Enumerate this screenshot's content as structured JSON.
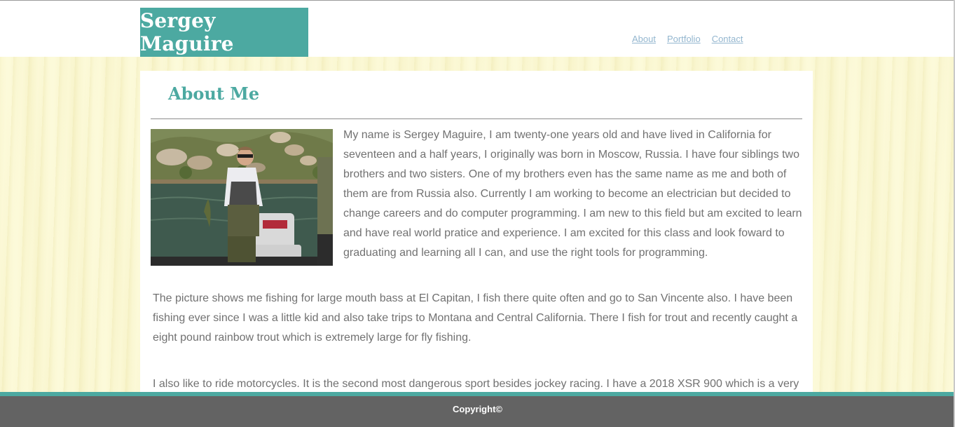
{
  "header": {
    "logo_text": "Sergey Maguire",
    "nav": [
      {
        "label": "About"
      },
      {
        "label": "Portfolio"
      },
      {
        "label": "Contact"
      }
    ]
  },
  "main": {
    "title": "About Me",
    "paragraphs": [
      "My name is Sergey Maguire, I am twenty-one years old and have lived in California for seventeen and a half years, I originally was born in Moscow, Russia. I have four siblings two brothers and two sisters. One of my brothers even has the same name as me and both of them are from Russia also. Currently I am working to become an electrician but decided to change careers and do computer programming. I am new to this field but am excited to learn and have real world pratice and experience. I am excited for this class and look foward to graduating and learning all I can, and use the right tools for programming.",
      "The picture shows me fishing for large mouth bass at El Capitan, I fish there quite often and go to San Vincente also. I have been fishing ever since I was a little kid and also take trips to Montana and Central California. There I fish for trout and recently caught a eight pound rainbow trout which is extremely large for fly fishing.",
      "I also like to ride motorcycles. It is the second most dangerous sport besides jockey racing. I have a 2018 XSR 900 which is a very"
    ]
  },
  "footer": {
    "copyright": "Copyright©"
  },
  "colors": {
    "accent": "#4ca9a1",
    "footer_bg": "#636363",
    "page_bg": "#fbf8d4",
    "nav_link": "#93b6cf",
    "body_text": "#717171"
  }
}
